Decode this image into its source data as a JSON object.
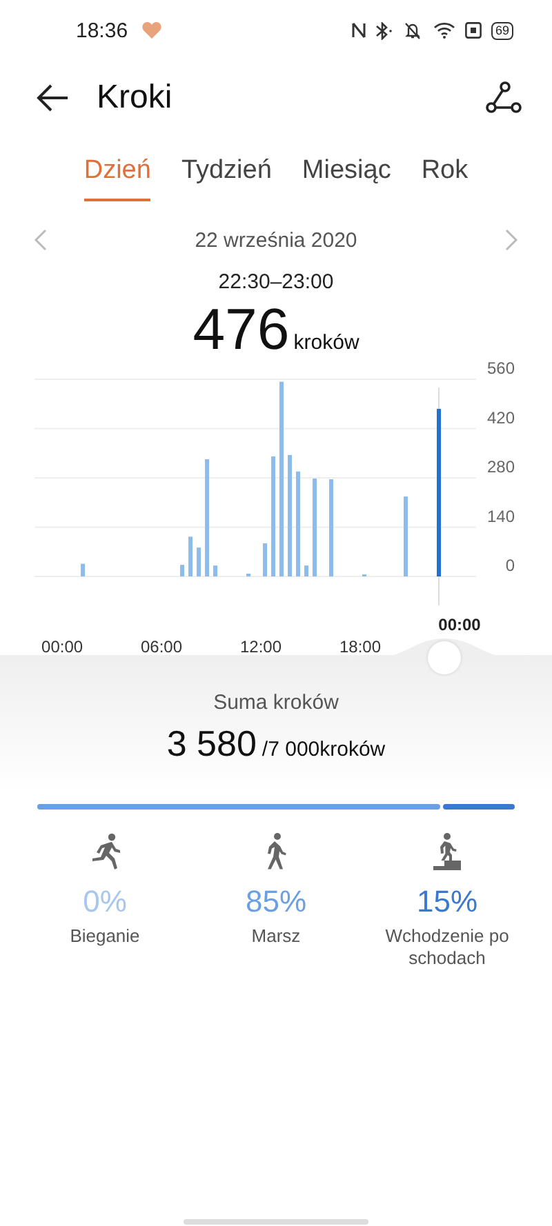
{
  "status_bar": {
    "time": "18:36",
    "battery": "69"
  },
  "header": {
    "title": "Kroki"
  },
  "tabs": [
    {
      "label": "Dzień",
      "selected": true
    },
    {
      "label": "Tydzień",
      "selected": false
    },
    {
      "label": "Miesiąc",
      "selected": false
    },
    {
      "label": "Rok",
      "selected": false
    }
  ],
  "date": "22 września 2020",
  "selection": {
    "range": "22:30–23:00",
    "value": "476",
    "unit": "kroków"
  },
  "chart": {
    "cursor_label": "00:00",
    "chart_data": {
      "type": "bar",
      "x": [
        1,
        7,
        7.5,
        8,
        8.5,
        9,
        11,
        12,
        12.5,
        13,
        13.5,
        14,
        14.5,
        15,
        16,
        18,
        20.5,
        22.5
      ],
      "series": [
        {
          "color": "#8dbcea",
          "values": [
            36,
            33,
            113,
            82,
            333,
            31,
            8,
            94,
            341,
            553,
            345,
            298,
            31,
            278,
            276,
            6,
            227,
            null
          ]
        },
        {
          "color": "#1f72d1",
          "values": [
            null,
            null,
            null,
            null,
            null,
            null,
            null,
            null,
            null,
            null,
            null,
            null,
            null,
            null,
            null,
            null,
            null,
            476
          ]
        }
      ],
      "xlim": [
        -1.67,
        25
      ],
      "grid": true,
      "ref_lines": [
        {
          "axis": "x",
          "value": 22.75
        }
      ],
      "ylim": [
        0,
        560
      ],
      "xticks": [
        {
          "value": 0,
          "label": "00:00"
        },
        {
          "value": 6,
          "label": "06:00"
        },
        {
          "value": 12,
          "label": "12:00"
        },
        {
          "value": 18,
          "label": "18:00"
        }
      ],
      "yticks": [
        0,
        140,
        280,
        420,
        560
      ]
    }
  },
  "summary": {
    "title": "Suma kroków",
    "total": "3 580",
    "goal": "/7 000kroków"
  },
  "activities": [
    {
      "kind": "run",
      "percent": "0%",
      "label": "Bieganie",
      "color": "#a8c7ee"
    },
    {
      "kind": "walk",
      "percent": "85%",
      "label": "Marsz",
      "color": "#6a9fe4"
    },
    {
      "kind": "stairs",
      "percent": "15%",
      "label": "Wchodzenie po schodach",
      "color": "#3b78cf"
    }
  ]
}
